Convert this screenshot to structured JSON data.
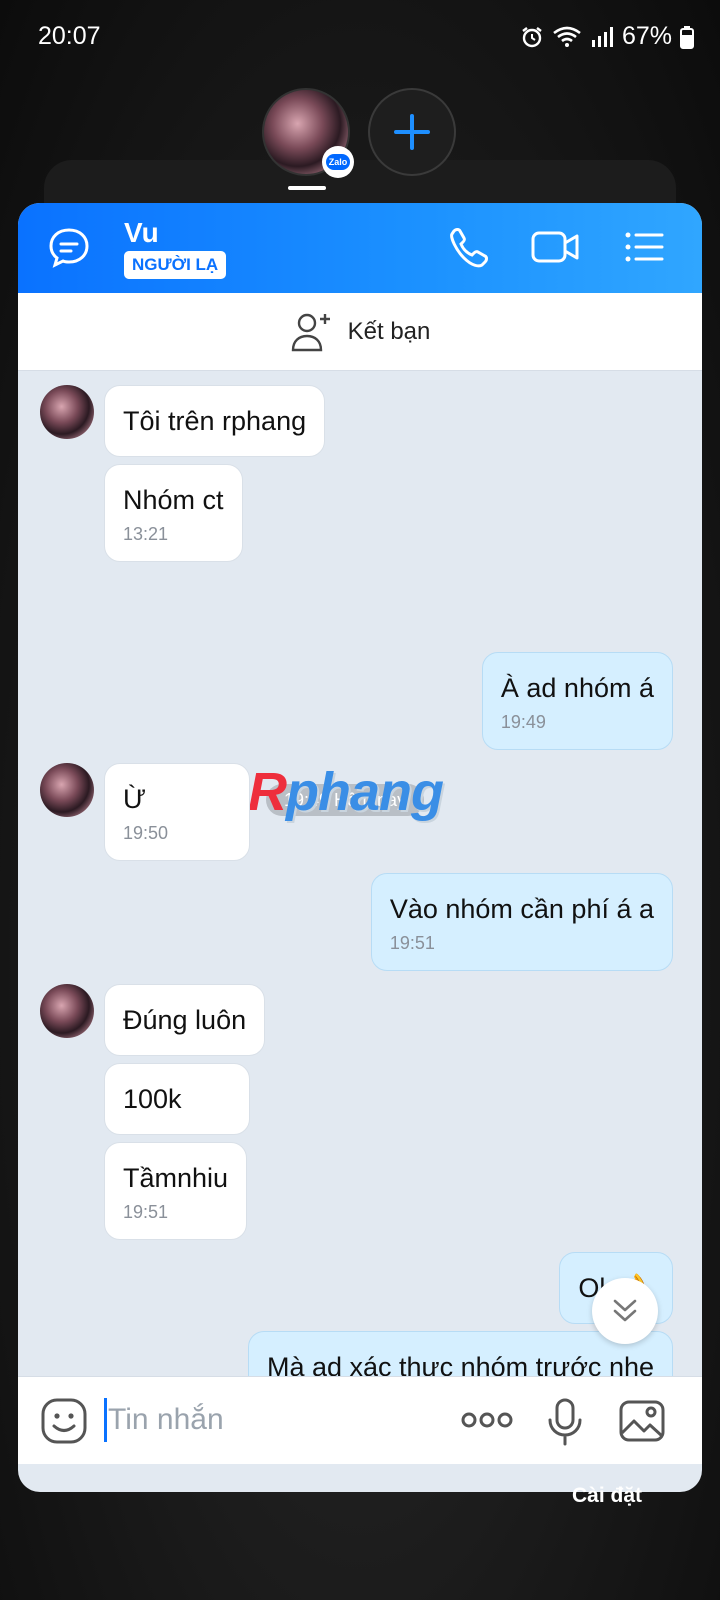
{
  "status_bar": {
    "time": "20:07",
    "battery": "67%"
  },
  "header": {
    "contact_name": "Vu",
    "badge": "NGƯỜI LẠ"
  },
  "friend_bar": {
    "label": "Kết bạn"
  },
  "messages": [
    {
      "dir": "in",
      "text": "Tôi trên rphang",
      "time": ""
    },
    {
      "dir": "in",
      "text": "Nhóm ct",
      "time": "13:21"
    },
    {
      "dir": "out",
      "text": "À ad nhóm á",
      "time": "19:49"
    },
    {
      "dir": "in",
      "text": "Ừ",
      "time": "19:50"
    },
    {
      "dir": "out",
      "text": "Vào nhóm cần phí á a",
      "time": "19:51"
    },
    {
      "dir": "in",
      "text": "Đúng luôn",
      "time": ""
    },
    {
      "dir": "in",
      "text": "100k",
      "time": ""
    },
    {
      "dir": "in",
      "text": "Tầmnhiu",
      "time": "19:51"
    },
    {
      "dir": "out",
      "text": "Ok 👌",
      "time": ""
    },
    {
      "dir": "out",
      "text": "Mà ad xác thực nhóm trước nhe",
      "time": ""
    }
  ],
  "date_divider": "19:49 Hôm nay",
  "watermark": {
    "first": "R",
    "rest": "phang"
  },
  "input": {
    "placeholder": "Tin nhắn"
  },
  "bottom_label": "Cài đặt",
  "colors": {
    "accent": "#0a72ff",
    "outgoing_bubble": "#d5efff",
    "chat_bg": "#e2e9f1"
  }
}
